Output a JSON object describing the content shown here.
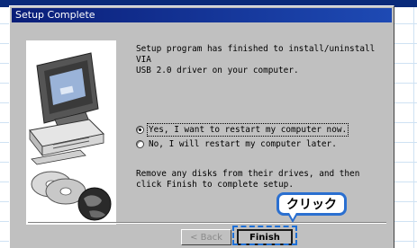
{
  "window": {
    "title": "Setup Complete"
  },
  "message": "Setup program has finished to install/uninstall VIA\nUSB 2.0 driver on your computer.",
  "restart_options": [
    {
      "label": "Yes, I want to restart my computer now.",
      "selected": true
    },
    {
      "label": "No, I will restart my computer later.",
      "selected": false
    }
  ],
  "remove_message": "Remove any disks from their drives, and then\nclick Finish to complete setup.",
  "buttons": {
    "back": "< Back",
    "finish": "Finish"
  },
  "annotation": {
    "callout": "クリック"
  },
  "colors": {
    "callout_border": "#2a6fd0",
    "titlebar": "#0a1e78"
  },
  "icons": [
    "computer-illustration-icon",
    "cd-disk-icon",
    "globe-icon"
  ]
}
